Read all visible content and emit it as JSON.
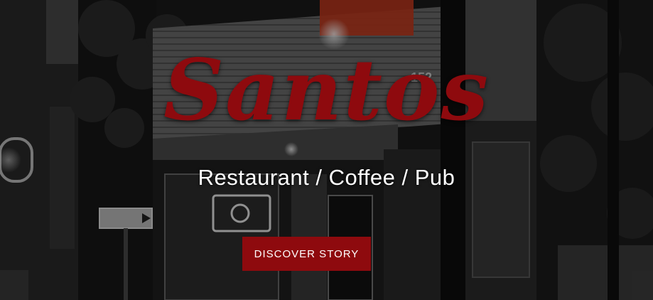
{
  "hero": {
    "brand": "Santos",
    "tagline": "Restaurant / Coffee / Pub",
    "street_number": "152",
    "cta_label": "DISCOVER STORY"
  },
  "colors": {
    "brand": "#8e0a0e",
    "cta_bg": "#8e0a0e",
    "cta_text": "#ffffff",
    "tagline": "#ffffff",
    "sign": "#d8351c"
  }
}
